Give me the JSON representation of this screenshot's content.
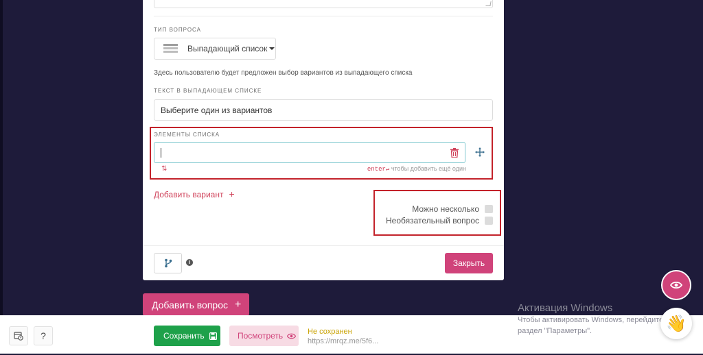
{
  "editor": {
    "question_type_label": "ТИП ВОПРОСА",
    "question_type_value": "Выпадающий список",
    "question_type_hint": "Здесь пользователю будет предложен выбор вариантов из выпадающего списка",
    "dropdown_text_label": "ТЕКСТ В ВЫПАДАЮЩЕМ СПИСКЕ",
    "dropdown_text_value": "Выберите один из вариантов",
    "list_items_label": "ЭЛЕМЕНТЫ СПИСКА",
    "list_item_value": "",
    "sort_glyph": "⇅",
    "enter_key": "enter↵",
    "enter_hint": " чтобы добавить ещё один",
    "add_variant_label": "Добавить вариант",
    "add_variant_plus": "+",
    "multiple_label": "Можно несколько",
    "optional_label": "Необязательный вопрос",
    "info_glyph": "i",
    "close_label": "Закрыть"
  },
  "add_question": {
    "label": "Добавить вопрос",
    "plus": "+"
  },
  "bottom_bar": {
    "help_label": "?",
    "save_label": "Сохранить",
    "preview_label": "Посмотреть",
    "status": "Не сохранен",
    "url": "https://mrqz.me/5f6..."
  },
  "windows_watermark": {
    "title": "Активация Windows",
    "line1": "Чтобы активировать Windows, перейдите в",
    "line2": "раздел \"Параметры\"."
  },
  "fab": {
    "wave_emoji": "👋"
  },
  "colors": {
    "accent": "#d0437a",
    "save_green": "#1ea14a",
    "status_yellow": "#c9a200",
    "highlight_red": "#c3222a",
    "background": "#1e1b3a"
  },
  "icons": [
    "list-icon",
    "trash-icon",
    "move-icon",
    "sort-icon",
    "branch-icon",
    "info-icon",
    "calendar-clock-icon",
    "save-icon",
    "eye-icon",
    "wave-icon"
  ]
}
